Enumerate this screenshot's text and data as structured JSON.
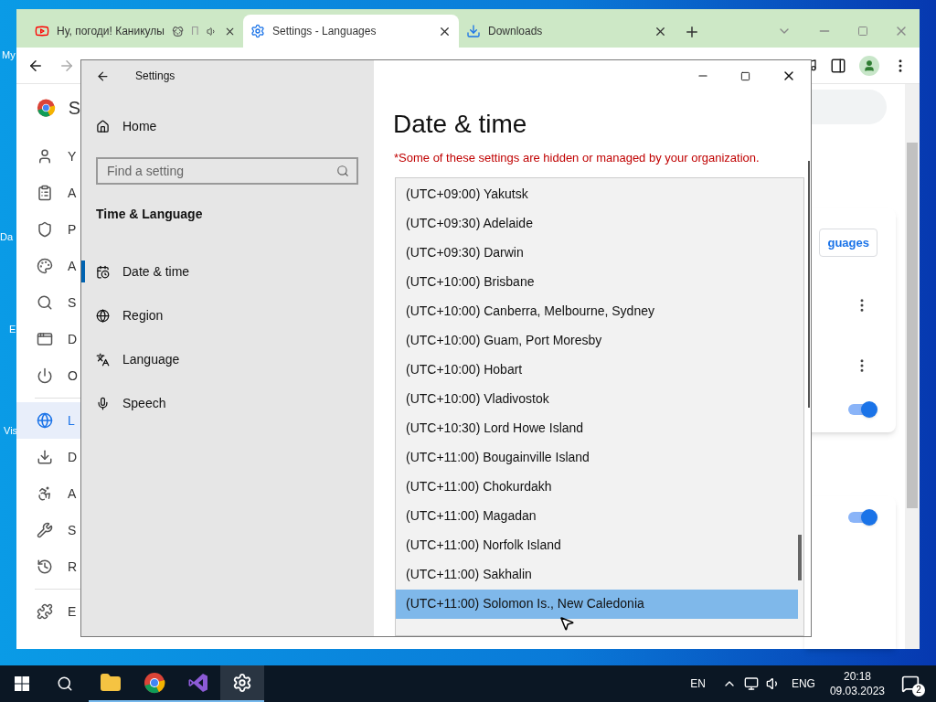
{
  "desktop": {
    "icon_labels": [
      "My",
      "Da",
      "E",
      "Vis"
    ]
  },
  "browser": {
    "tabs": [
      {
        "kind": "video",
        "title": "Ну, погоди! Каникулы",
        "title_tail": "П",
        "selected": false
      },
      {
        "kind": "settings",
        "title": "Settings - Languages",
        "selected": true
      },
      {
        "kind": "download",
        "title": "Downloads",
        "selected": false
      }
    ],
    "header_letter": "S",
    "sidebar": [
      {
        "label": "Y",
        "selected": false
      },
      {
        "label": "A",
        "selected": false
      },
      {
        "label": "P",
        "selected": false
      },
      {
        "label": "A",
        "selected": false
      },
      {
        "label": "S",
        "selected": false
      },
      {
        "label": "D",
        "selected": false
      },
      {
        "label": "O",
        "selected": false
      },
      {
        "label": "L",
        "selected": true
      },
      {
        "label": "D",
        "selected": false
      },
      {
        "label": "A",
        "selected": false
      },
      {
        "label": "S",
        "selected": false
      },
      {
        "label": "R",
        "selected": false
      },
      {
        "label": "E",
        "selected": false
      }
    ],
    "languages_button": "guages",
    "toggles": [
      {
        "on": true
      },
      {
        "on": true
      }
    ]
  },
  "settings": {
    "title": "Settings",
    "home": "Home",
    "search": {
      "placeholder": "Find a setting"
    },
    "section": "Time & Language",
    "nav": [
      {
        "label": "Date & time",
        "selected": true
      },
      {
        "label": "Region",
        "selected": false
      },
      {
        "label": "Language",
        "selected": false
      },
      {
        "label": "Speech",
        "selected": false
      }
    ],
    "page_title": "Date & time",
    "warning": "*Some of these settings are hidden or managed by your organization.",
    "timezones": [
      {
        "label": "(UTC+09:00) Yakutsk",
        "selected": false
      },
      {
        "label": "(UTC+09:30) Adelaide",
        "selected": false
      },
      {
        "label": "(UTC+09:30) Darwin",
        "selected": false
      },
      {
        "label": "(UTC+10:00) Brisbane",
        "selected": false
      },
      {
        "label": "(UTC+10:00) Canberra, Melbourne, Sydney",
        "selected": false
      },
      {
        "label": "(UTC+10:00) Guam, Port Moresby",
        "selected": false
      },
      {
        "label": "(UTC+10:00) Hobart",
        "selected": false
      },
      {
        "label": "(UTC+10:00) Vladivostok",
        "selected": false
      },
      {
        "label": "(UTC+10:30) Lord Howe Island",
        "selected": false
      },
      {
        "label": "(UTC+11:00) Bougainville Island",
        "selected": false
      },
      {
        "label": "(UTC+11:00) Chokurdakh",
        "selected": false
      },
      {
        "label": "(UTC+11:00) Magadan",
        "selected": false
      },
      {
        "label": "(UTC+11:00) Norfolk Island",
        "selected": false
      },
      {
        "label": "(UTC+11:00) Sakhalin",
        "selected": false
      },
      {
        "label": "(UTC+11:00) Solomon Is., New Caledonia",
        "selected": true
      }
    ]
  },
  "taskbar": {
    "apps": [
      {
        "kind": "folder",
        "active": false
      },
      {
        "kind": "chrome",
        "active": false
      },
      {
        "kind": "studio",
        "active": false
      },
      {
        "kind": "settings",
        "active": true
      }
    ],
    "input": "EN",
    "lang": "ENG",
    "time": "20:18",
    "date": "09.03.2023",
    "notifications": "2"
  }
}
